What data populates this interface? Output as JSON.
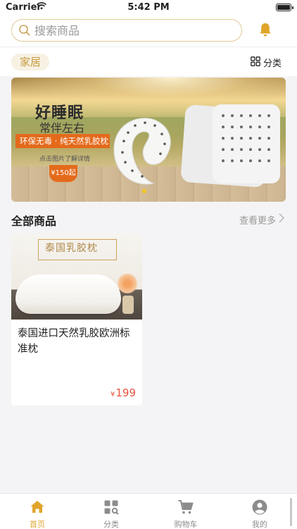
{
  "status_bar": {
    "carrier": "Carrier",
    "time": "5:42 PM"
  },
  "search": {
    "placeholder": "搜索商品"
  },
  "category": {
    "active": "家居",
    "all_label": "分类"
  },
  "banner": {
    "title": "好睡眠",
    "subtitle": "常伴左右",
    "ribbon": "环保无毒 · 纯天然乳胶枕",
    "hint": "点击图片了解详情",
    "price_badge": "¥150起"
  },
  "section": {
    "title": "全部商品",
    "more": "查看更多"
  },
  "products": [
    {
      "image_title": "泰国乳胶枕",
      "name": "泰国进口天然乳胶欧洲标准枕",
      "currency": "¥",
      "price": "199"
    }
  ],
  "tabs": [
    {
      "label": "首页",
      "icon": "home-icon",
      "active": true
    },
    {
      "label": "分类",
      "icon": "category-icon",
      "active": false
    },
    {
      "label": "购物车",
      "icon": "cart-icon",
      "active": false
    },
    {
      "label": "我的",
      "icon": "profile-icon",
      "active": false
    }
  ],
  "colors": {
    "accent": "#e0a52a",
    "price": "#e5533d",
    "chip_bg": "#f7f1e3",
    "banner_orange": "#e46a1b"
  }
}
